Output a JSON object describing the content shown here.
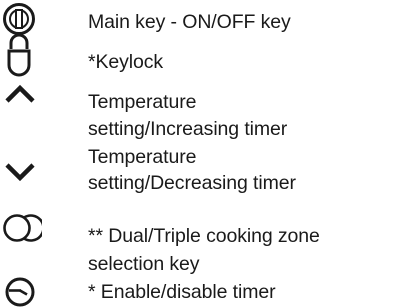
{
  "legend": [
    {
      "icon": "power-key-icon",
      "lines": [
        "Main key - ON/OFF key"
      ]
    },
    {
      "icon": "padlock-icon",
      "lines": [
        "*Keylock"
      ]
    },
    {
      "icon": "chevron-up-icon",
      "lines": [
        "Temperature",
        "setting/Increasing timer"
      ]
    },
    {
      "icon": "chevron-down-icon",
      "lines": [
        "Temperature",
        "setting/Decreasing timer"
      ]
    },
    {
      "icon": "dual-zone-circles-icon",
      "lines": [
        "** Dual/Triple cooking zone",
        "selection key"
      ]
    },
    {
      "icon": "timer-clock-icon",
      "lines": [
        "* Enable/disable timer"
      ]
    }
  ]
}
